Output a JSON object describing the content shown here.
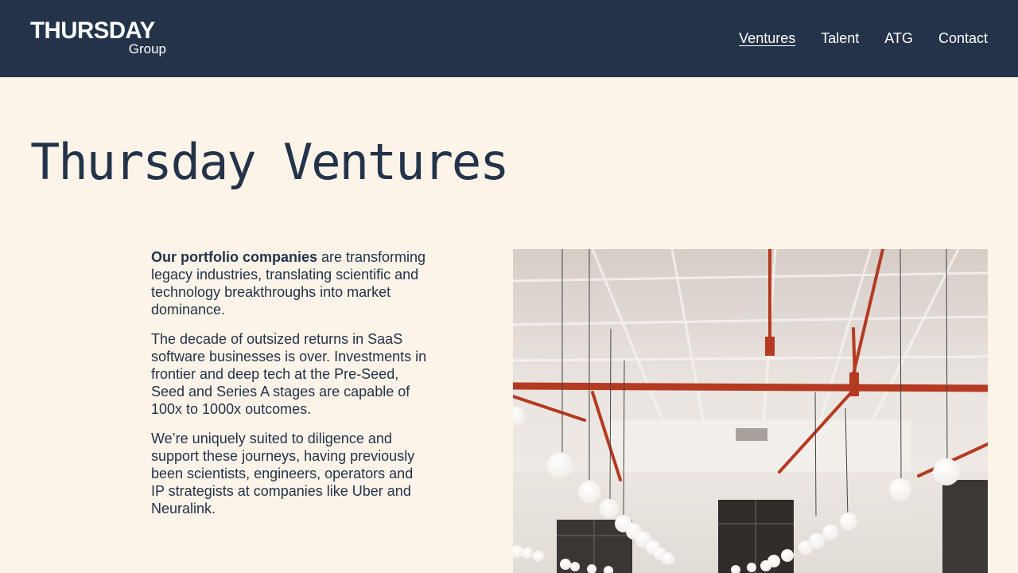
{
  "header": {
    "logo": {
      "main": "THURSDAY",
      "sub": "Group"
    },
    "nav": [
      {
        "label": "Ventures",
        "active": true
      },
      {
        "label": "Talent",
        "active": false
      },
      {
        "label": "ATG",
        "active": false
      },
      {
        "label": "Contact",
        "active": false
      }
    ]
  },
  "main": {
    "title": "Thursday Ventures",
    "paragraphs": {
      "p1_bold": "Our portfolio companies",
      "p1_rest": " are transforming legacy industries, translating scientific and technology breakthroughs into market dominance.",
      "p2": "The decade of outsized returns in SaaS software businesses is over. Investments in frontier and deep tech at the Pre-Seed, Seed and Series A stages are capable of 100x to 1000x outcomes.",
      "p3": "We’re uniquely suited to diligence and support these journeys, having previously been scientists, engineers, operators and IP strategists at companies like Uber and Neuralink."
    },
    "image": {
      "subject": "office interior with hanging light bulbs and red pipes"
    }
  },
  "colors": {
    "header_bg": "#24334a",
    "page_bg": "#fcf4e8",
    "text": "#24334a",
    "pipe_red": "#b43a22"
  }
}
